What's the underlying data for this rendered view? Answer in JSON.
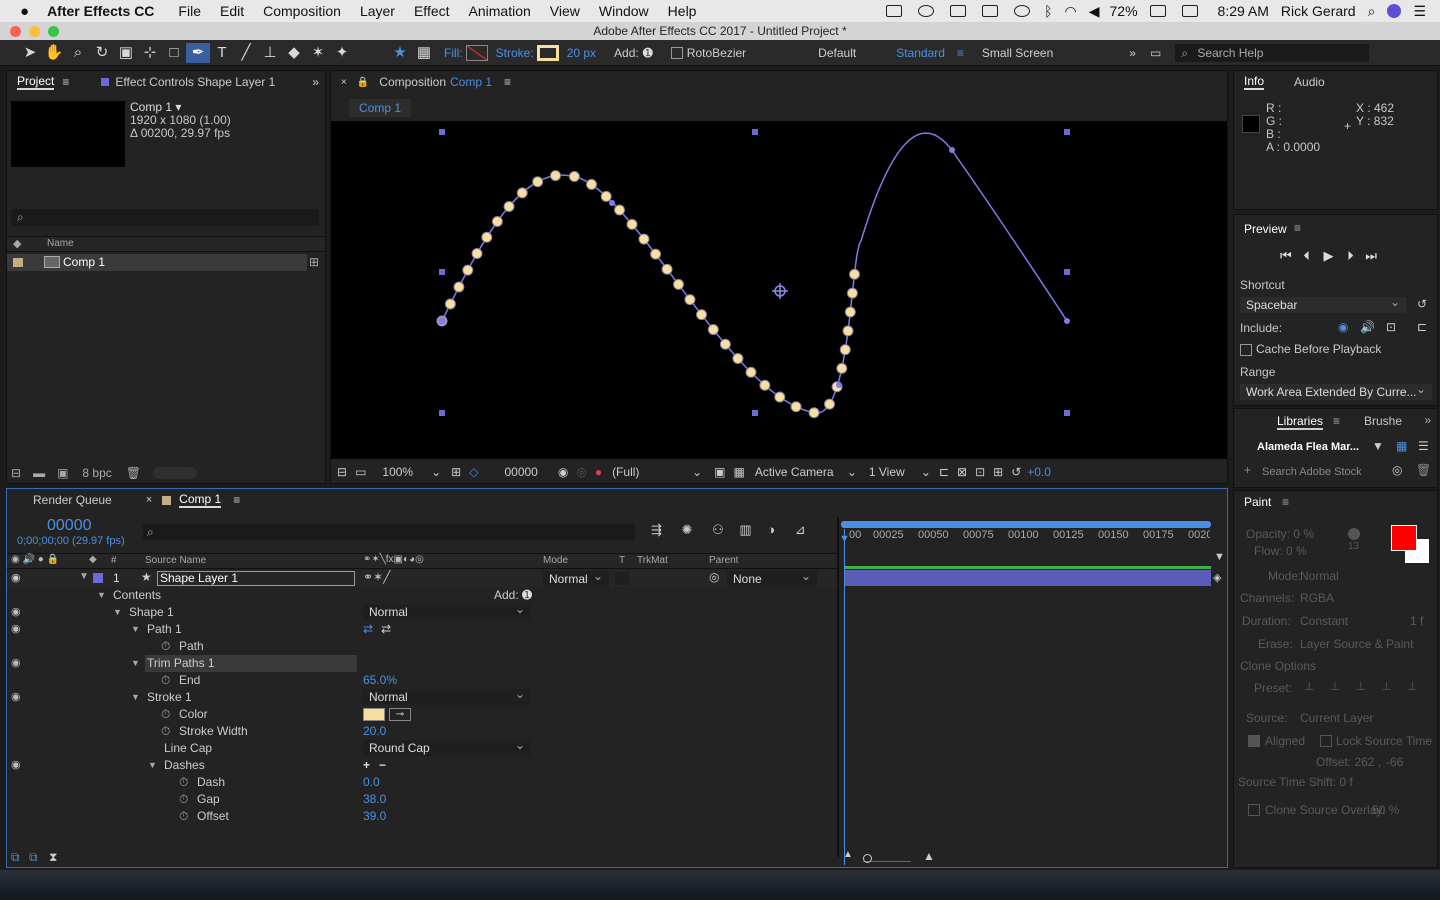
{
  "menubar": {
    "app_name": "After Effects CC",
    "items": [
      "File",
      "Edit",
      "Composition",
      "Layer",
      "Effect",
      "Animation",
      "View",
      "Window",
      "Help"
    ],
    "battery": "72%",
    "time": "8:29 AM",
    "user": "Rick Gerard"
  },
  "window_title": "Adobe After Effects CC 2017 - Untitled Project *",
  "toolbar": {
    "fill_label": "Fill:",
    "stroke_label": "Stroke:",
    "stroke_width": "20 px",
    "add_label": "Add:",
    "rotobezier_label": "RotoBezier",
    "workspaces": [
      "Default",
      "Standard",
      "Small Screen"
    ],
    "search_placeholder": "Search Help"
  },
  "project_panel": {
    "tab_project": "Project",
    "tab_effect_controls": "Effect Controls Shape Layer 1",
    "comp_name": "Comp 1 ▾",
    "comp_res": "1920 x 1080 (1.00)",
    "comp_dur": "Δ 00200, 29.97 fps",
    "col_name": "Name",
    "item_name": "Comp 1",
    "bpc": "8 bpc"
  },
  "composition_panel": {
    "tab_label": "Composition",
    "tab_comp": "Comp 1",
    "breadcrumb": "Comp 1",
    "zoom": "100%",
    "timecode": "00000",
    "resolution": "(Full)",
    "camera": "Active Camera",
    "views": "1 View",
    "exposure": "+0.0"
  },
  "info_panel": {
    "tab_info": "Info",
    "tab_audio": "Audio",
    "r": "R :",
    "g": "G :",
    "b": "B :",
    "a": "A : 0.0000",
    "x": "X : 462",
    "y": "Y : 832"
  },
  "preview_panel": {
    "title": "Preview",
    "shortcut_label": "Shortcut",
    "shortcut_value": "Spacebar",
    "include_label": "Include:",
    "cache_label": "Cache Before Playback",
    "range_label": "Range",
    "range_value": "Work Area Extended By Curre..."
  },
  "libraries_panel": {
    "tab_libraries": "Libraries",
    "tab_brushes": "Brushe",
    "library_name": "Alameda Flea Mar...",
    "search_placeholder": "Search Adobe Stock"
  },
  "paint_panel": {
    "title": "Paint",
    "opacity": "Opacity: 0 %",
    "flow": "Flow: 0 %",
    "brush_size": "13",
    "mode_label": "Mode:",
    "mode_value": "Normal",
    "channels_label": "Channels:",
    "channels_value": "RGBA",
    "duration_label": "Duration:",
    "duration_value": "Constant",
    "duration_frames": "1 f",
    "erase_label": "Erase:",
    "erase_value": "Layer Source & Paint",
    "clone_options": "Clone Options",
    "preset_label": "Preset:",
    "source_label": "Source:",
    "source_value": "Current Layer",
    "aligned_label": "Aligned",
    "lock_label": "Lock Source Time",
    "offset_label": "Offset: 262 ,",
    "offset_y": "-66",
    "shift_label": "Source Time Shift: 0 f",
    "overlay_label": "Clone Source Overlay:",
    "overlay_value": "50 %"
  },
  "timeline": {
    "tab_render": "Render Queue",
    "tab_comp": "Comp 1",
    "timecode": "00000",
    "timecode_sub": "0;00;00;00 (29.97 fps)",
    "col_source": "Source Name",
    "col_mode": "Mode",
    "col_t": "T",
    "col_trkmat": "TrkMat",
    "col_parent": "Parent",
    "layer_num": "1",
    "layer_name": "Shape Layer 1",
    "layer_mode": "Normal",
    "layer_parent": "None",
    "contents": "Contents",
    "add_label": "Add:",
    "shape1": "Shape 1",
    "shape1_mode": "Normal",
    "path1": "Path 1",
    "path": "Path",
    "trim": "Trim Paths 1",
    "end": "End",
    "end_val": "65.0%",
    "stroke1": "Stroke 1",
    "stroke1_mode": "Normal",
    "color": "Color",
    "stroke_width": "Stroke Width",
    "stroke_width_val": "20.0",
    "line_cap": "Line Cap",
    "line_cap_val": "Round Cap",
    "dashes": "Dashes",
    "dash": "Dash",
    "dash_val": "0.0",
    "gap": "Gap",
    "gap_val": "38.0",
    "offset": "Offset",
    "offset_val": "39.0",
    "ruler": [
      "00",
      "00025",
      "00050",
      "00075",
      "00100",
      "00125",
      "00150",
      "00175",
      "0020"
    ]
  },
  "colors": {
    "accent": "#4a90e2",
    "stroke_color": "#f7dfa0",
    "path_color": "#7d7de8",
    "layer_bar": "#5b5bb8",
    "paint_fg": "#ff0000"
  }
}
